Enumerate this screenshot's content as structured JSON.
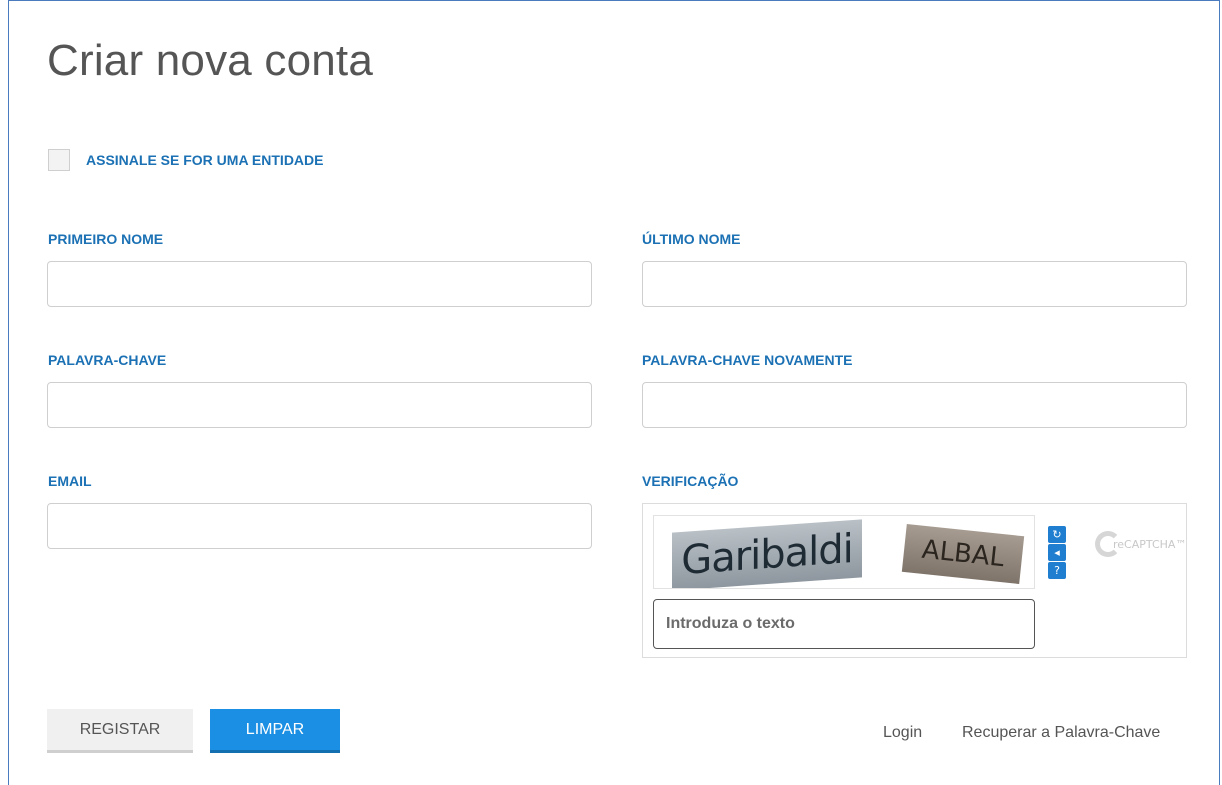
{
  "page": {
    "title": "Criar nova conta"
  },
  "entity_checkbox": {
    "label": "ASSINALE SE FOR UMA ENTIDADE",
    "checked": false
  },
  "fields": {
    "first_name": {
      "label": "PRIMEIRO NOME",
      "value": ""
    },
    "last_name": {
      "label": "ÚLTIMO NOME",
      "value": ""
    },
    "password": {
      "label": "PALAVRA-CHAVE",
      "value": ""
    },
    "password_again": {
      "label": "PALAVRA-CHAVE NOVAMENTE",
      "value": ""
    },
    "email": {
      "label": "EMAIL",
      "value": ""
    }
  },
  "verification": {
    "label": "VERIFICAÇÃO",
    "captcha_words": [
      "Garibaldi",
      "ALBAL"
    ],
    "input_placeholder": "Introduza o texto",
    "buttons": [
      "refresh-icon",
      "audio-icon",
      "help-icon"
    ],
    "logo_text": "reCAPTCHA™"
  },
  "actions": {
    "register": "REGISTAR",
    "clear": "LIMPAR",
    "login": "Login",
    "recover": "Recuperar a Palavra-Chave"
  },
  "colors": {
    "accent": "#1b71b4",
    "primary_button": "#1a8fe3",
    "frame": "#4a7bbf"
  }
}
